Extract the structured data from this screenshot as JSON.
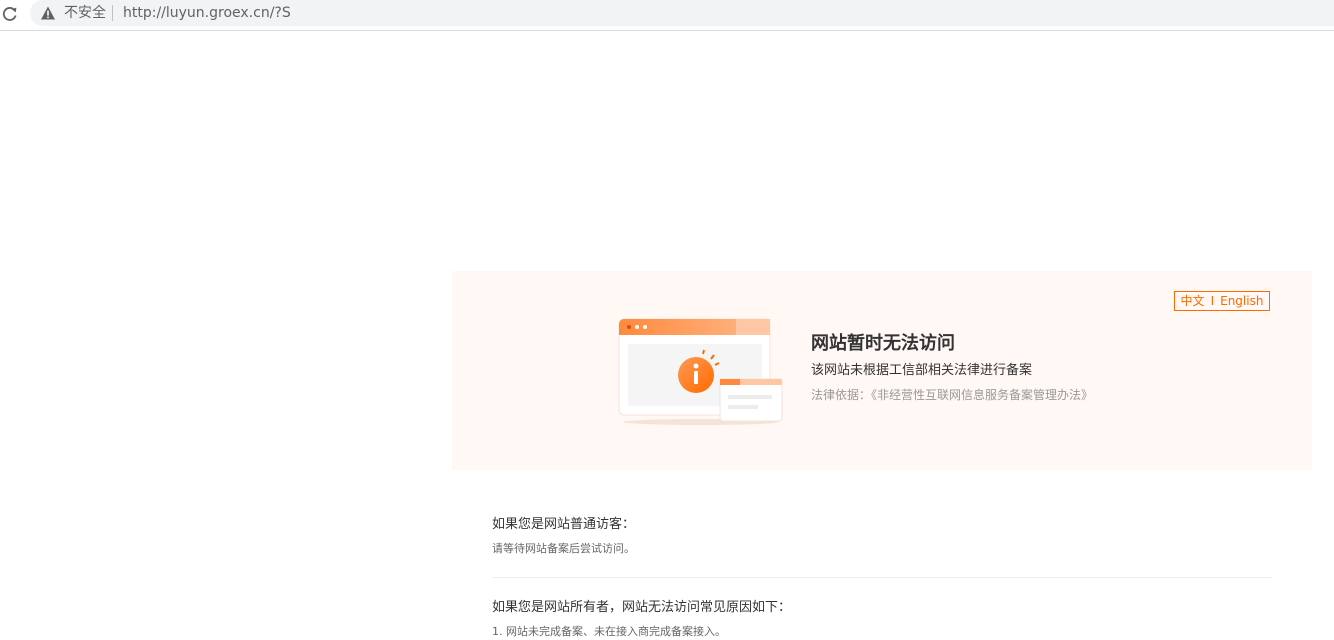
{
  "browser": {
    "security_label": "不安全",
    "url": "http://luyun.groex.cn/?S"
  },
  "notice": {
    "lang_zh": "中文",
    "lang_sep": "I",
    "lang_en": "English",
    "title": "网站暂时无法访问",
    "description": "该网站未根据工信部相关法律进行备案",
    "basis": "法律依据：《非经营性互联网信息服务备案管理办法》"
  },
  "visitor": {
    "title": "如果您是网站普通访客：",
    "text": "请等待网站备案后尝试访问。"
  },
  "owner": {
    "title": "如果您是网站所有者，网站无法访问常见原因如下：",
    "reasons": [
      "1. 网站未完成备案、未在接入商完成备案接入。"
    ]
  },
  "colors": {
    "accent": "#ff6a00",
    "notice_bg": "#fff8f5"
  },
  "icons": {
    "reload": "reload-icon",
    "warning": "warning-icon",
    "illustration": "info-window-illustration"
  }
}
